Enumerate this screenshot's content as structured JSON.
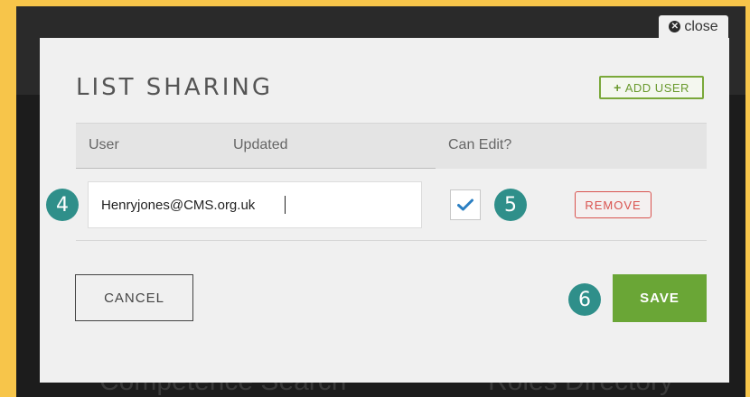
{
  "close_tab": {
    "icon": "close-circle-icon",
    "label": "close"
  },
  "modal": {
    "title": "LIST SHARING",
    "add_user": {
      "icon": "plus-icon",
      "label": "ADD USER"
    },
    "table": {
      "headers": {
        "user": "User",
        "updated": "Updated",
        "can_edit": "Can Edit?"
      },
      "rows": [
        {
          "email": "Henryjones@CMS.org.uk",
          "can_edit": true,
          "remove_label": "REMOVE"
        }
      ]
    },
    "cancel_label": "CANCEL",
    "save_label": "SAVE"
  },
  "annotations": {
    "email_step": "4",
    "checkbox_step": "5",
    "save_step": "6"
  },
  "background": {
    "left_text": "Competence Search",
    "right_text": "Roles Directory"
  },
  "colors": {
    "frame": "#f7c54a",
    "accent_green": "#6aa636",
    "remove_red": "#d9534f",
    "badge_teal": "#2f8f8a",
    "check_blue": "#2b7fc2"
  }
}
